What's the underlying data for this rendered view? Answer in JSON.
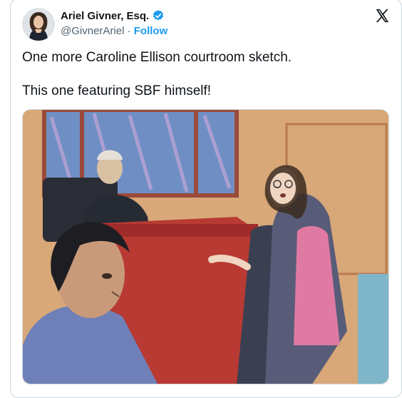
{
  "author": {
    "display_name": "Ariel Givner, Esq.",
    "handle": "@GivnerAriel",
    "separator": "·",
    "follow_label": "Follow"
  },
  "tweet": {
    "lines": [
      "One more Caroline Ellison courtroom sketch.",
      "This one featuring SBF himself!"
    ]
  },
  "icons": {
    "verified": "verified-badge-icon",
    "platform": "x-logo-icon"
  },
  "colors": {
    "accent": "#1d9bf0",
    "text_primary": "#0f1419",
    "text_secondary": "#536471",
    "border": "#cfd9de"
  }
}
